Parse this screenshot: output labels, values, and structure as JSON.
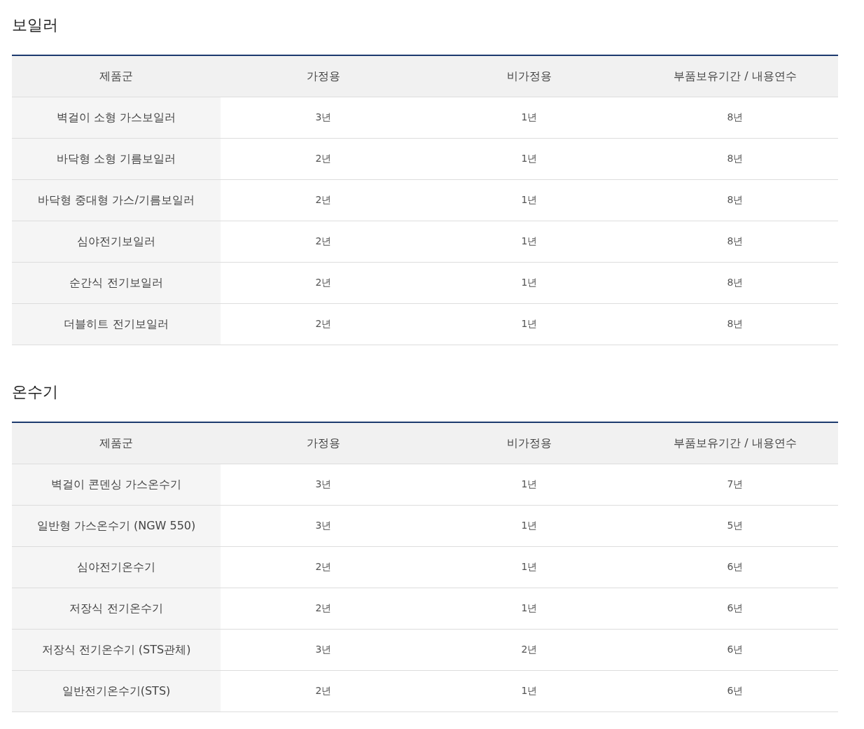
{
  "sections": [
    {
      "title": "보일러",
      "columns": [
        "제품군",
        "가정용",
        "비가정용",
        "부품보유기간 / 내용연수"
      ],
      "rows": [
        [
          "벽걸이 소형 가스보일러",
          "3년",
          "1년",
          "8년"
        ],
        [
          "바닥형 소형 기름보일러",
          "2년",
          "1년",
          "8년"
        ],
        [
          "바닥형 중대형 가스/기름보일러",
          "2년",
          "1년",
          "8년"
        ],
        [
          "심야전기보일러",
          "2년",
          "1년",
          "8년"
        ],
        [
          "순간식 전기보일러",
          "2년",
          "1년",
          "8년"
        ],
        [
          "더블히트 전기보일러",
          "2년",
          "1년",
          "8년"
        ]
      ]
    },
    {
      "title": "온수기",
      "columns": [
        "제품군",
        "가정용",
        "비가정용",
        "부품보유기간 / 내용연수"
      ],
      "rows": [
        [
          "벽걸이 콘덴싱 가스온수기",
          "3년",
          "1년",
          "7년"
        ],
        [
          "일반형 가스온수기 (NGW 550)",
          "3년",
          "1년",
          "5년"
        ],
        [
          "심야전기온수기",
          "2년",
          "1년",
          "6년"
        ],
        [
          "저장식 전기온수기",
          "2년",
          "1년",
          "6년"
        ],
        [
          "저장식 전기온수기 (STS관체)",
          "3년",
          "2년",
          "6년"
        ],
        [
          "일반전기온수기(STS)",
          "2년",
          "1년",
          "6년"
        ]
      ]
    }
  ]
}
